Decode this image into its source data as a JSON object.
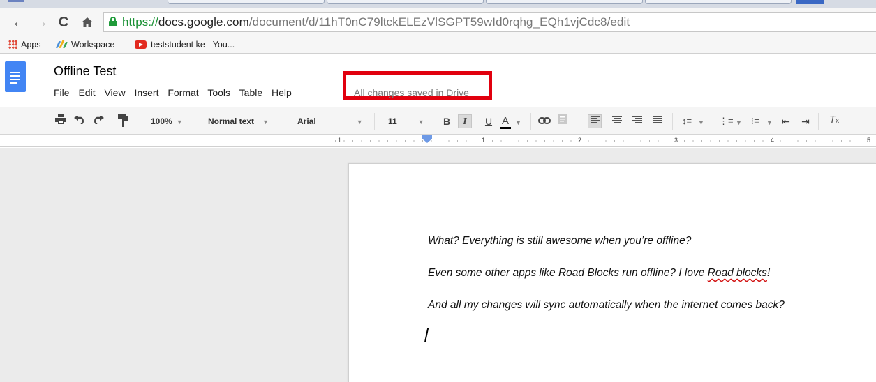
{
  "browser": {
    "nav": {
      "back_icon": "arrow-left-icon",
      "forward_icon": "arrow-right-icon",
      "reload_icon": "reload-icon",
      "home_icon": "home-icon"
    },
    "omnibox": {
      "url_scheme": "https://",
      "url_host": "docs.google.com",
      "url_path": "/document/d/11hT0nC79ltckELEzVlSGPT59wId0rqhg_EQh1vjCdc8/edit",
      "secure_color": "#1a9135"
    },
    "bookmarks": [
      {
        "label": "Apps",
        "icon": "apps-grid-icon"
      },
      {
        "label": "Workspace",
        "icon": "workspace-icon"
      },
      {
        "label": "teststudent ke - You...",
        "icon": "youtube-icon"
      }
    ]
  },
  "docs": {
    "title": "Offline Test",
    "menu": [
      "File",
      "Edit",
      "View",
      "Insert",
      "Format",
      "Tools",
      "Table",
      "Help"
    ],
    "save_status": "All changes saved in Drive",
    "highlight_color": "#e1000e",
    "accent_color": "#4285f4",
    "toolbar": {
      "zoom": "100%",
      "style": "Normal text",
      "font": "Arial",
      "size": "11",
      "bold": "B",
      "italic": "I",
      "underline": "U",
      "text_color": "A",
      "italic_active": true
    },
    "ruler_numbers": [
      "1",
      "1",
      "2",
      "3",
      "4",
      "5"
    ],
    "body": [
      "What? Everything is still awesome when you’re offline?",
      "Even some other apps like Road Blocks run offline? I love ",
      "And all my changes will sync automatically when the internet comes back?"
    ],
    "misspelled": "Road blocks",
    "after_misspelled": "!"
  }
}
